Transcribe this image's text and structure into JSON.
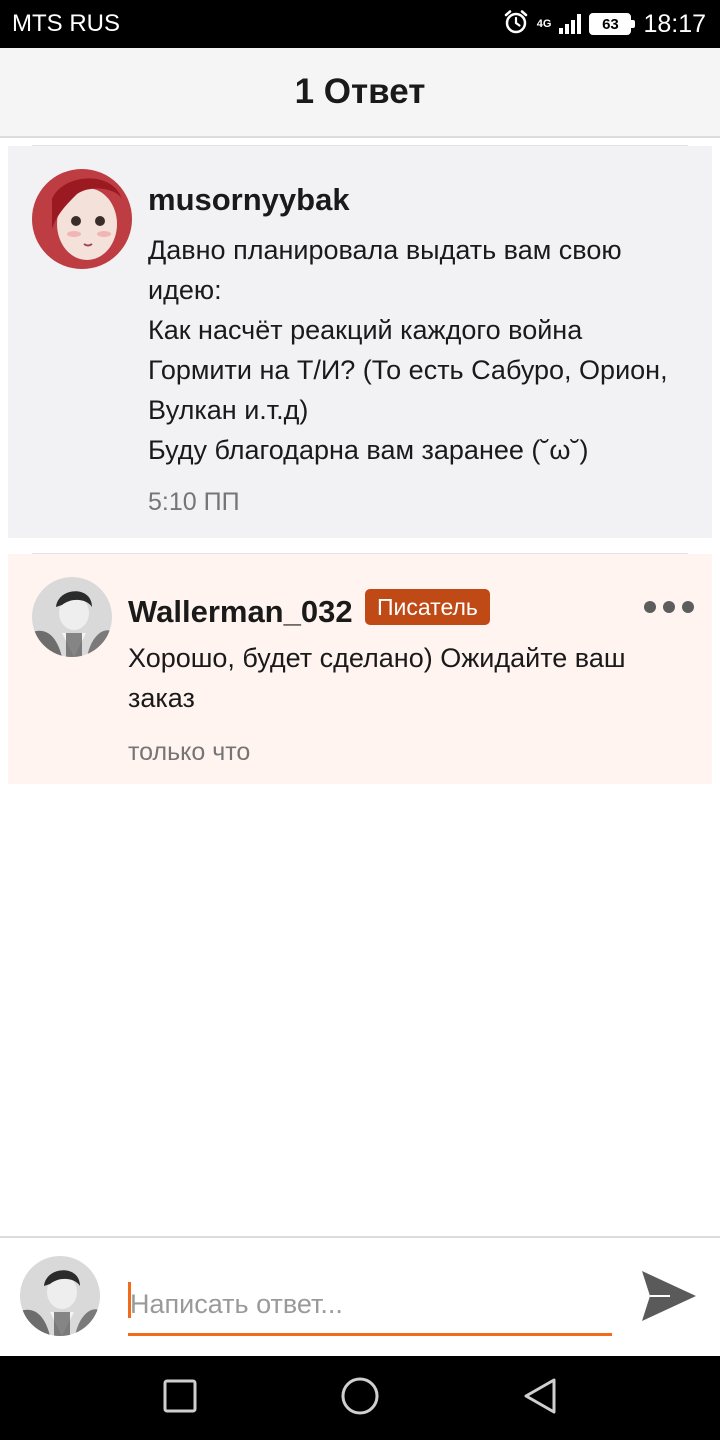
{
  "status_bar": {
    "carrier": "MTS RUS",
    "network": "4G",
    "battery": "63",
    "time": "18:17",
    "icons": [
      "alarm-icon",
      "signal-icon",
      "battery-icon"
    ]
  },
  "header": {
    "title": "1 Ответ"
  },
  "original_comment": {
    "username": "musornyybak",
    "text": "Давно планировала выдать вам свою\nидею:\nКак насчёт реакций каждого война\nГормити на Т/И? (То есть Сабуро, Орион,\nВулкан и.т.д)\nБуду благодарна вам заранее  (˘ω˘)",
    "timestamp": "5:10 ПП"
  },
  "reply_comment": {
    "username": "Wallerman_032",
    "badge": "Писатель",
    "text": "Хорошо, будет сделано) Ожидайте ваш\nзаказ",
    "timestamp": "только что"
  },
  "composer": {
    "placeholder": "Написать ответ...",
    "value": ""
  },
  "colors": {
    "accent": "#f26a1c",
    "badge": "#c04a15",
    "original_bg": "#f2f2f4",
    "reply_bg": "#fff4f0"
  }
}
